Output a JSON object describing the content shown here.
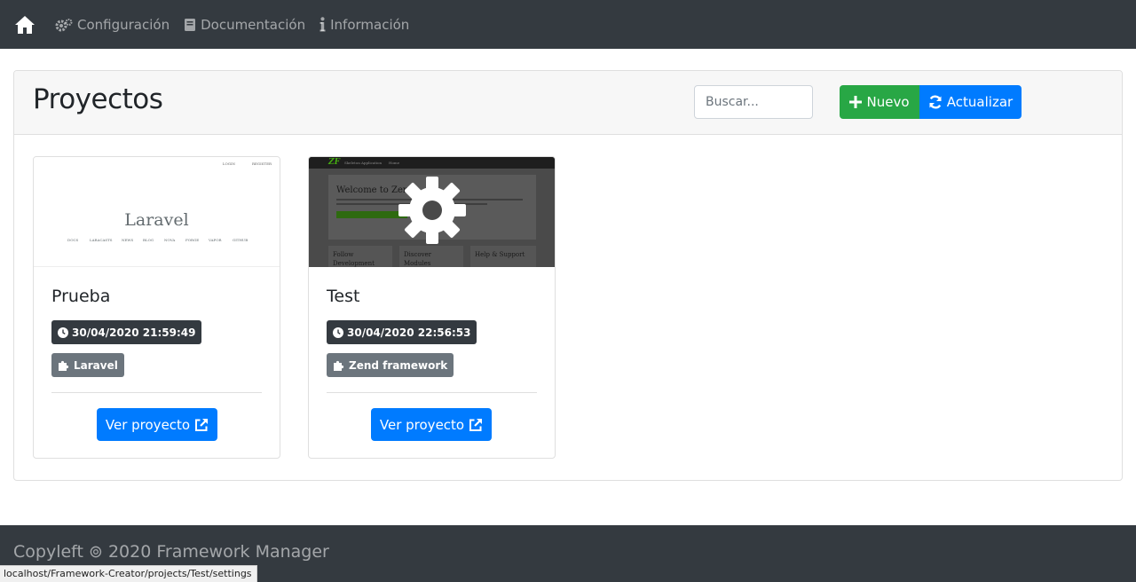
{
  "navbar": {
    "home_icon": "home-icon",
    "links": [
      {
        "label": "Configuración",
        "icon": "cogs-icon"
      },
      {
        "label": "Documentación",
        "icon": "book-icon"
      },
      {
        "label": "Información",
        "icon": "info-icon"
      }
    ]
  },
  "header": {
    "title": "Proyectos",
    "search_placeholder": "Buscar...",
    "new_label": "Nuevo",
    "refresh_label": "Actualizar"
  },
  "projects": [
    {
      "name": "Prueba",
      "date": "30/04/2020 21:59:49",
      "framework": "Laravel",
      "view_label": "Ver proyecto",
      "thumb": {
        "title": "Laravel",
        "top_links": [
          "LOGIN",
          "REGISTER"
        ],
        "links": [
          "DOCS",
          "LARACASTS",
          "NEWS",
          "BLOG",
          "NOVA",
          "FORGE",
          "VAPOR",
          "GITHUB"
        ]
      }
    },
    {
      "name": "Test",
      "date": "30/04/2020 22:56:53",
      "framework": "Zend framework",
      "view_label": "Ver proyecto",
      "thumb": {
        "logo": "ZF",
        "nav": [
          "Skeleton Application",
          "Home"
        ],
        "welcome": "Welcome to Zend",
        "cols": [
          "Follow Development",
          "Discover Modules",
          "Help & Support"
        ],
        "overlay_icon": "gear-icon"
      }
    }
  ],
  "footer": {
    "text": "Copyleft ⊚ 2020 Framework Manager"
  },
  "status_bar": {
    "url": "localhost/Framework-Creator/projects/Test/settings"
  },
  "colors": {
    "navbar": "#343a40",
    "primary": "#007bff",
    "success": "#28a745",
    "secondary": "#6c757d",
    "dark": "#343a40"
  }
}
